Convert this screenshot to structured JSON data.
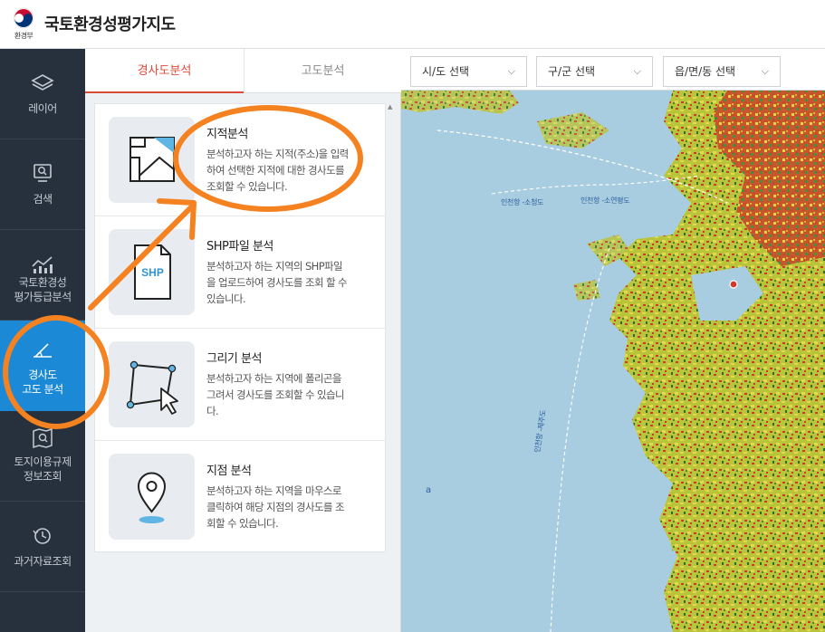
{
  "header": {
    "logo_sub": "환경부",
    "title": "국토환경성평가지도"
  },
  "sidebar": {
    "items": [
      {
        "label": "레이어",
        "icon": "layers-icon"
      },
      {
        "label": "검색",
        "icon": "search-icon"
      },
      {
        "label": "국토환경성\n평가등급분석",
        "icon": "chart-icon"
      },
      {
        "label": "경사도\n고도 분석",
        "icon": "slope-icon"
      },
      {
        "label": "토지이용규제\n정보조회",
        "icon": "map-search-icon"
      },
      {
        "label": "과거자료조회",
        "icon": "history-icon"
      }
    ],
    "active_index": 3
  },
  "panel": {
    "tabs": [
      "경사도분석",
      "고도분석"
    ],
    "cards": [
      {
        "title": "지적분석",
        "desc": "분석하고자 하는 지적(주소)을 입력\n하여 선택한 지적에 대한 경사도를\n조회할 수 있습니다.",
        "icon": "parcel-map-icon"
      },
      {
        "title": "SHP파일 분석",
        "desc": "분석하고자 하는 지역의 SHP파일\n을 업로드하여 경사도를 조회 할 수\n있습니다.",
        "icon": "shp-file-icon",
        "badge": "SHP"
      },
      {
        "title": "그리기 분석",
        "desc": "분석하고자 하는 지역에 폴리곤을\n그려서 경사도를 조회할 수 있습니\n다.",
        "icon": "polygon-draw-icon"
      },
      {
        "title": "지점 분석",
        "desc": "분석하고자 하는 지역을 마우스로\n클릭하여 해당 지점의 경사도를 조\n회할 수 있습니다.",
        "icon": "location-pin-icon"
      }
    ],
    "collapse_glyph": "‹"
  },
  "map": {
    "selects": [
      {
        "value": "시/도 선택"
      },
      {
        "value": "구/군 선택"
      },
      {
        "value": "읍/면/동 선택"
      }
    ],
    "labels": [
      "인천항 -소청도",
      "인천항 -소연평도",
      "인천항 -제주도"
    ],
    "marker": "a"
  },
  "colors": {
    "accent": "#d94c3a",
    "sidebar_bg": "#26313d",
    "sidebar_active": "#1c89d6",
    "annotation": "#f58220",
    "sea": "#a9cde0"
  }
}
